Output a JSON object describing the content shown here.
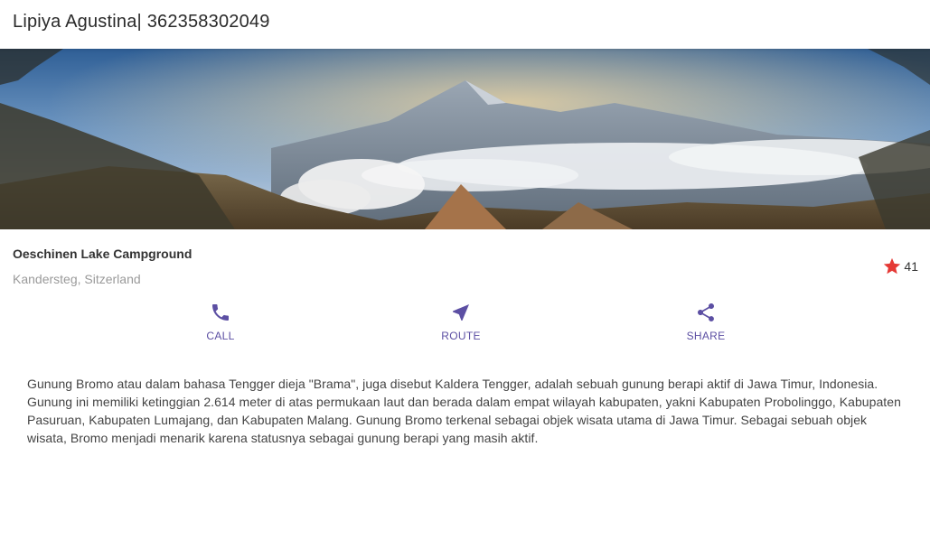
{
  "appbar": {
    "title": "Lipiya Agustina| 362358302049"
  },
  "hero": {
    "image_icon": "mountain-landscape-photo"
  },
  "place": {
    "name": "Oeschinen Lake Campground",
    "location": "Kandersteg, Sitzerland",
    "rating_count": "41",
    "rating_icon": "star-icon"
  },
  "actions": [
    {
      "label": "CALL",
      "icon": "phone-icon"
    },
    {
      "label": "ROUTE",
      "icon": "navigation-icon"
    },
    {
      "label": "SHARE",
      "icon": "share-icon"
    }
  ],
  "description": "Gunung Bromo atau dalam bahasa Tengger dieja \"Brama\", juga disebut Kaldera Tengger, adalah sebuah gunung berapi aktif di Jawa Timur, Indonesia. Gunung ini memiliki ketinggian 2.614 meter di atas permukaan laut dan berada dalam empat wilayah kabupaten, yakni Kabupaten Probolinggo, Kabupaten Pasuruan, Kabupaten Lumajang, dan Kabupaten Malang. Gunung Bromo terkenal sebagai objek wisata utama di Jawa Timur. Sebagai sebuah objek wisata, Bromo menjadi menarik karena statusnya sebagai gunung berapi yang masih aktif.",
  "colors": {
    "accent": "#5c4fa3",
    "star": "#e53935",
    "muted_text": "#9a9a9a"
  }
}
